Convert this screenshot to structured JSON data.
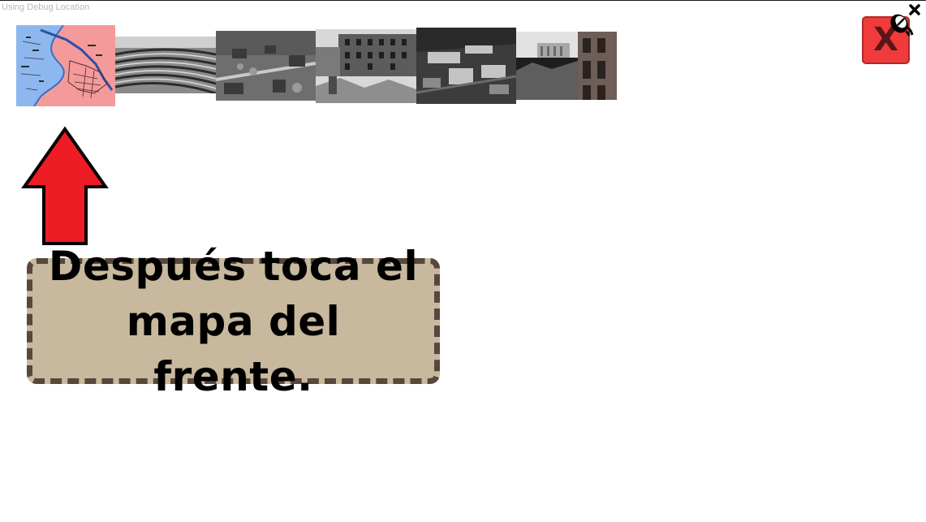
{
  "debug": {
    "label": "Using Debug Location"
  },
  "thumbnails": [
    {
      "name": "front-map",
      "icon": "map-thumbnail"
    },
    {
      "name": "amphitheater-ruins-photo",
      "icon": "photo-thumbnail"
    },
    {
      "name": "aerial-ruins-photo",
      "icon": "photo-thumbnail"
    },
    {
      "name": "damaged-building-photo",
      "icon": "photo-thumbnail"
    },
    {
      "name": "aerial-campus-photo",
      "icon": "photo-thumbnail"
    },
    {
      "name": "street-ruins-photo",
      "icon": "photo-thumbnail"
    }
  ],
  "close_button": {
    "label": "X",
    "icon": "close-icon"
  },
  "arrow": {
    "icon": "arrow-up-icon",
    "color": "#ee1c24"
  },
  "instruction": {
    "text": "Después toca el mapa del frente."
  },
  "colors": {
    "close_bg": "#ef3b3b",
    "box_bg": "#c8b89d",
    "box_border": "#58473d",
    "map_land": "#f49a9a",
    "map_water": "#8cb8ef"
  }
}
